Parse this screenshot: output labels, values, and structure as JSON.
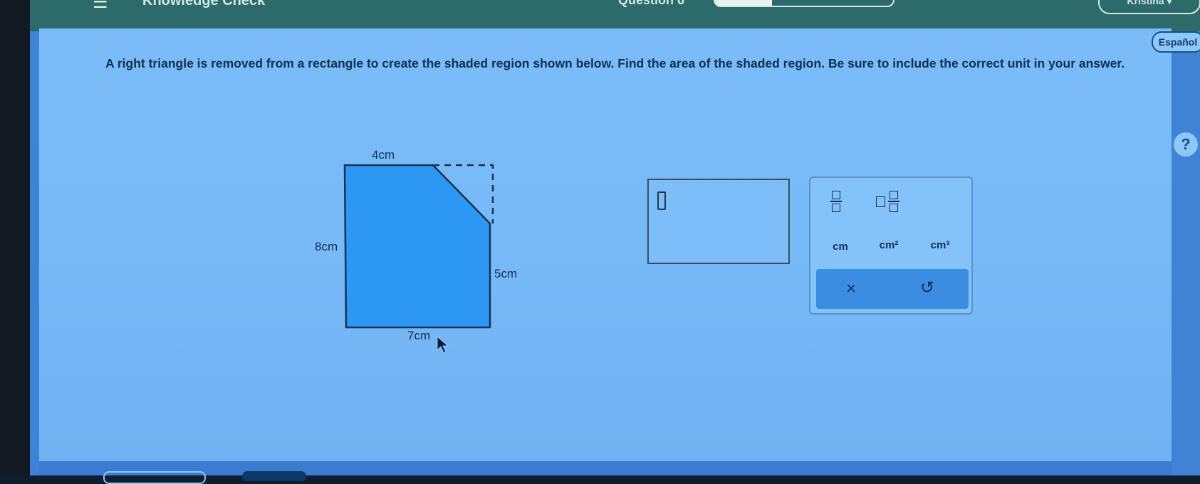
{
  "header": {
    "app_title": "Knowledge Check",
    "question_label": "Question 6",
    "progress_fraction": 0.32,
    "user_name": "Kristina"
  },
  "language_button": "Español",
  "help_button": "?",
  "prompt": "A right triangle is removed from a rectangle to create the shaded region shown below. Find the area of the shaded region. Be sure to include the correct unit in your answer.",
  "figure": {
    "top_label": "4cm",
    "left_label": "8cm",
    "right_label": "5cm",
    "bottom_label": "7cm",
    "shade_color": "#2d97f4"
  },
  "answer": {
    "value": ""
  },
  "keypad": {
    "unit_keys": [
      "cm",
      "cm²",
      "cm³"
    ],
    "clear_key": "×",
    "undo_key": "↺"
  }
}
